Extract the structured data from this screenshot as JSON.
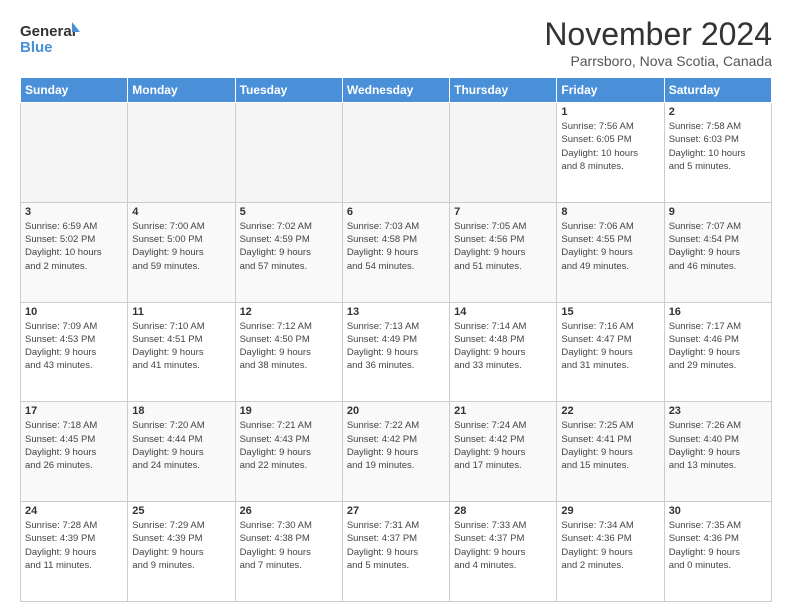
{
  "logo": {
    "line1": "General",
    "line2": "Blue"
  },
  "title": "November 2024",
  "subtitle": "Parrsboro, Nova Scotia, Canada",
  "weekdays": [
    "Sunday",
    "Monday",
    "Tuesday",
    "Wednesday",
    "Thursday",
    "Friday",
    "Saturday"
  ],
  "weeks": [
    [
      {
        "day": "",
        "info": ""
      },
      {
        "day": "",
        "info": ""
      },
      {
        "day": "",
        "info": ""
      },
      {
        "day": "",
        "info": ""
      },
      {
        "day": "",
        "info": ""
      },
      {
        "day": "1",
        "info": "Sunrise: 7:56 AM\nSunset: 6:05 PM\nDaylight: 10 hours\nand 8 minutes."
      },
      {
        "day": "2",
        "info": "Sunrise: 7:58 AM\nSunset: 6:03 PM\nDaylight: 10 hours\nand 5 minutes."
      }
    ],
    [
      {
        "day": "3",
        "info": "Sunrise: 6:59 AM\nSunset: 5:02 PM\nDaylight: 10 hours\nand 2 minutes."
      },
      {
        "day": "4",
        "info": "Sunrise: 7:00 AM\nSunset: 5:00 PM\nDaylight: 9 hours\nand 59 minutes."
      },
      {
        "day": "5",
        "info": "Sunrise: 7:02 AM\nSunset: 4:59 PM\nDaylight: 9 hours\nand 57 minutes."
      },
      {
        "day": "6",
        "info": "Sunrise: 7:03 AM\nSunset: 4:58 PM\nDaylight: 9 hours\nand 54 minutes."
      },
      {
        "day": "7",
        "info": "Sunrise: 7:05 AM\nSunset: 4:56 PM\nDaylight: 9 hours\nand 51 minutes."
      },
      {
        "day": "8",
        "info": "Sunrise: 7:06 AM\nSunset: 4:55 PM\nDaylight: 9 hours\nand 49 minutes."
      },
      {
        "day": "9",
        "info": "Sunrise: 7:07 AM\nSunset: 4:54 PM\nDaylight: 9 hours\nand 46 minutes."
      }
    ],
    [
      {
        "day": "10",
        "info": "Sunrise: 7:09 AM\nSunset: 4:53 PM\nDaylight: 9 hours\nand 43 minutes."
      },
      {
        "day": "11",
        "info": "Sunrise: 7:10 AM\nSunset: 4:51 PM\nDaylight: 9 hours\nand 41 minutes."
      },
      {
        "day": "12",
        "info": "Sunrise: 7:12 AM\nSunset: 4:50 PM\nDaylight: 9 hours\nand 38 minutes."
      },
      {
        "day": "13",
        "info": "Sunrise: 7:13 AM\nSunset: 4:49 PM\nDaylight: 9 hours\nand 36 minutes."
      },
      {
        "day": "14",
        "info": "Sunrise: 7:14 AM\nSunset: 4:48 PM\nDaylight: 9 hours\nand 33 minutes."
      },
      {
        "day": "15",
        "info": "Sunrise: 7:16 AM\nSunset: 4:47 PM\nDaylight: 9 hours\nand 31 minutes."
      },
      {
        "day": "16",
        "info": "Sunrise: 7:17 AM\nSunset: 4:46 PM\nDaylight: 9 hours\nand 29 minutes."
      }
    ],
    [
      {
        "day": "17",
        "info": "Sunrise: 7:18 AM\nSunset: 4:45 PM\nDaylight: 9 hours\nand 26 minutes."
      },
      {
        "day": "18",
        "info": "Sunrise: 7:20 AM\nSunset: 4:44 PM\nDaylight: 9 hours\nand 24 minutes."
      },
      {
        "day": "19",
        "info": "Sunrise: 7:21 AM\nSunset: 4:43 PM\nDaylight: 9 hours\nand 22 minutes."
      },
      {
        "day": "20",
        "info": "Sunrise: 7:22 AM\nSunset: 4:42 PM\nDaylight: 9 hours\nand 19 minutes."
      },
      {
        "day": "21",
        "info": "Sunrise: 7:24 AM\nSunset: 4:42 PM\nDaylight: 9 hours\nand 17 minutes."
      },
      {
        "day": "22",
        "info": "Sunrise: 7:25 AM\nSunset: 4:41 PM\nDaylight: 9 hours\nand 15 minutes."
      },
      {
        "day": "23",
        "info": "Sunrise: 7:26 AM\nSunset: 4:40 PM\nDaylight: 9 hours\nand 13 minutes."
      }
    ],
    [
      {
        "day": "24",
        "info": "Sunrise: 7:28 AM\nSunset: 4:39 PM\nDaylight: 9 hours\nand 11 minutes."
      },
      {
        "day": "25",
        "info": "Sunrise: 7:29 AM\nSunset: 4:39 PM\nDaylight: 9 hours\nand 9 minutes."
      },
      {
        "day": "26",
        "info": "Sunrise: 7:30 AM\nSunset: 4:38 PM\nDaylight: 9 hours\nand 7 minutes."
      },
      {
        "day": "27",
        "info": "Sunrise: 7:31 AM\nSunset: 4:37 PM\nDaylight: 9 hours\nand 5 minutes."
      },
      {
        "day": "28",
        "info": "Sunrise: 7:33 AM\nSunset: 4:37 PM\nDaylight: 9 hours\nand 4 minutes."
      },
      {
        "day": "29",
        "info": "Sunrise: 7:34 AM\nSunset: 4:36 PM\nDaylight: 9 hours\nand 2 minutes."
      },
      {
        "day": "30",
        "info": "Sunrise: 7:35 AM\nSunset: 4:36 PM\nDaylight: 9 hours\nand 0 minutes."
      }
    ]
  ]
}
